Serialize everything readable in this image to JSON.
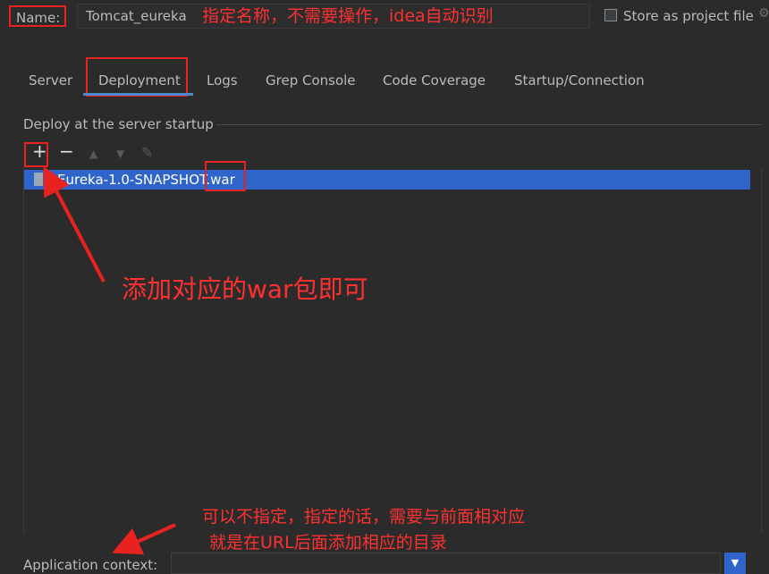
{
  "header": {
    "name_label": "Name:",
    "name_value": "Tomcat_eureka",
    "name_annotation": "指定名称，不需要操作，idea自动识别",
    "store_label": "Store as project file",
    "gear_icon": "gear-icon"
  },
  "tabs": [
    {
      "label": "Server"
    },
    {
      "label": "Deployment"
    },
    {
      "label": "Logs"
    },
    {
      "label": "Grep Console"
    },
    {
      "label": "Code Coverage"
    },
    {
      "label": "Startup/Connection"
    }
  ],
  "deploy": {
    "section_title": "Deploy at the server startup",
    "toolbar": {
      "add": "+",
      "remove": "−",
      "up": "▲",
      "down": "▼",
      "edit": "✎"
    },
    "items": [
      {
        "label": "Eureka-1.0-SNAPSHOT.war",
        "icon": "artifact-icon"
      }
    ],
    "annotation": "添加对应的war包即可"
  },
  "app_context": {
    "label": "Application context:",
    "value": "",
    "annotation_line1": "可以不指定，指定的话，需要与前面相对应",
    "annotation_line2": "就是在URL后面添加相应的目录"
  },
  "colors": {
    "background": "#2b2b2b",
    "selection": "#2f65ca",
    "annotation_red": "#ff3030",
    "tab_underline": "#4a88c7"
  }
}
